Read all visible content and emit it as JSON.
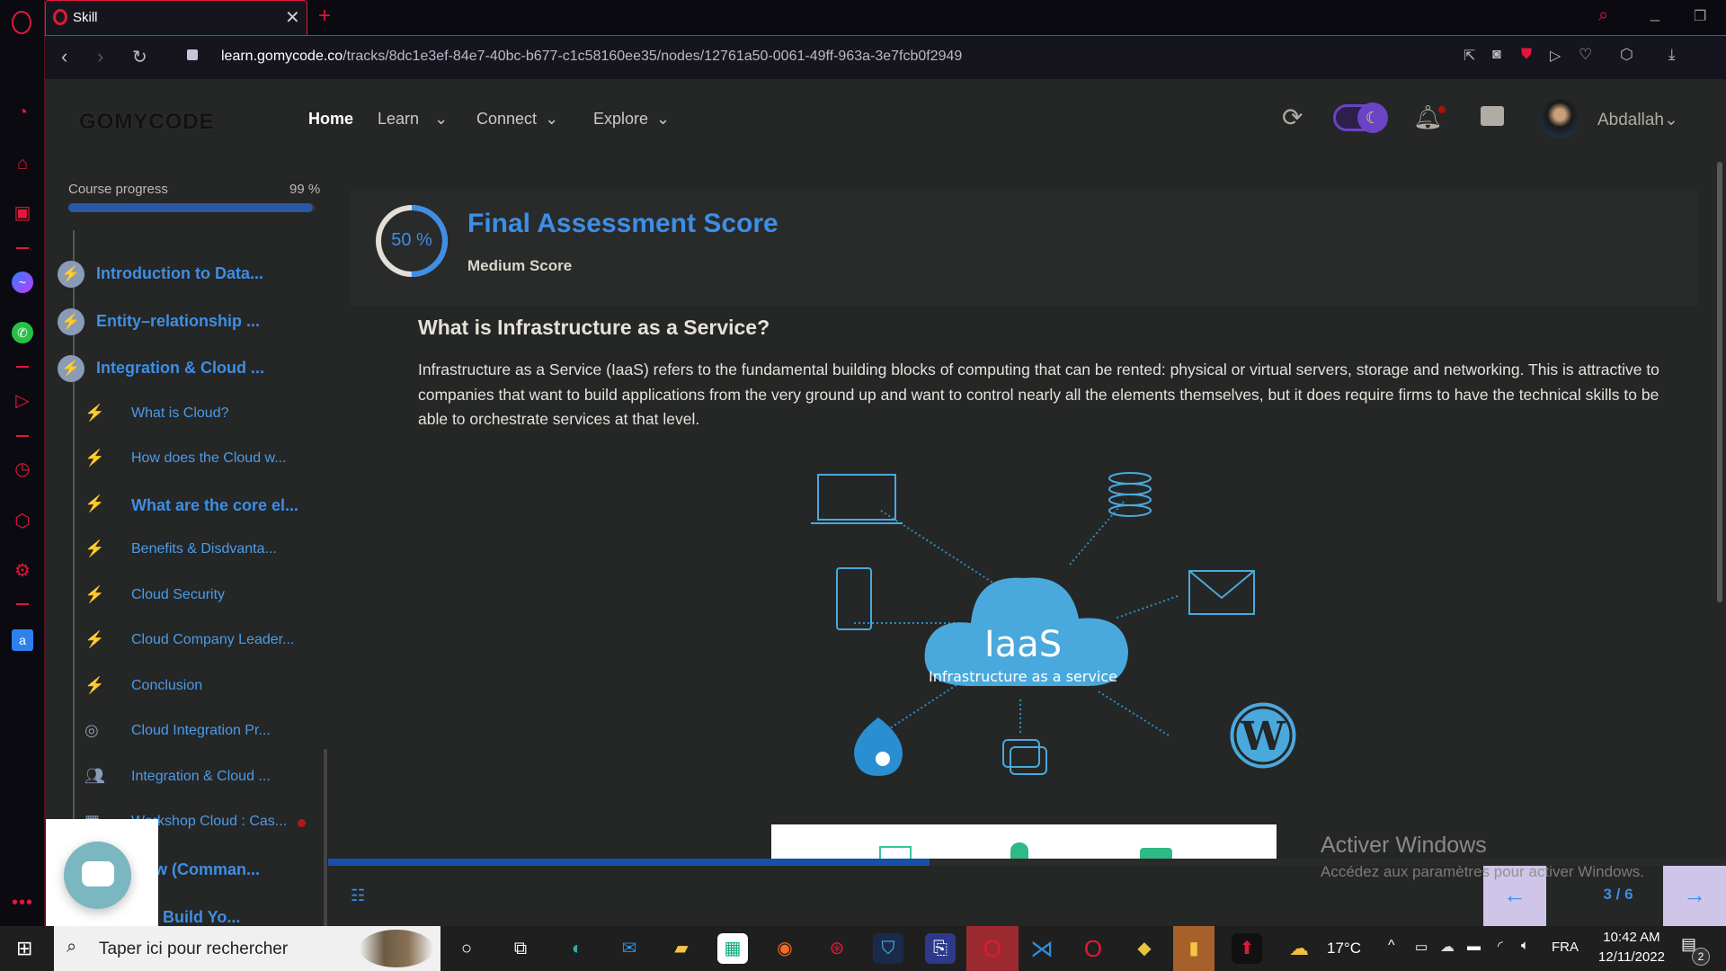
{
  "browser": {
    "tab_title": "Skill",
    "url_host": "learn.gomycode.co",
    "url_path": "/tracks/8dc1e3ef-84e7-40bc-b677-c1c58160ee35/nodes/12761a50-0061-49ff-963a-3e7fcb0f2949"
  },
  "header": {
    "logo": "GOMYCODE",
    "nav": [
      {
        "label": "Home"
      },
      {
        "label": "Learn"
      },
      {
        "label": "Connect"
      },
      {
        "label": "Explore"
      }
    ],
    "user": "Abdallah"
  },
  "sidebar": {
    "progress_label": "Course progress",
    "progress_text": "99 %",
    "progress": 0.99,
    "items": [
      {
        "label": "Introduction to Data...",
        "type": "module"
      },
      {
        "label": "Entity–relationship ...",
        "type": "module"
      },
      {
        "label": "Integration & Cloud ...",
        "type": "module"
      },
      {
        "label": "What is Cloud?",
        "type": "lesson"
      },
      {
        "label": "How does the Cloud w...",
        "type": "lesson"
      },
      {
        "label": "What are the core el...",
        "type": "lesson-active"
      },
      {
        "label": "Benefits & Disdvanta...",
        "type": "lesson"
      },
      {
        "label": "Cloud Security",
        "type": "lesson"
      },
      {
        "label": "Cloud Company Leader...",
        "type": "lesson"
      },
      {
        "label": "Conclusion",
        "type": "lesson"
      },
      {
        "label": "Cloud Integration Pr...",
        "type": "project"
      },
      {
        "label": "Integration & Cloud ...",
        "type": "group"
      },
      {
        "label": "Workshop Cloud : Cas...",
        "type": "workshop"
      },
      {
        "label": "Flow (Comman...",
        "type": "module"
      },
      {
        "label": "se : Build Yo...",
        "type": "module"
      }
    ]
  },
  "score": {
    "percent_text": "50 %",
    "percent": 50,
    "title": "Final Assessment Score",
    "subtitle": "Medium Score"
  },
  "content": {
    "heading": "What is Infrastructure as a Service?",
    "paragraph": "Infrastructure as a Service (IaaS) refers to the fundamental building blocks of computing that can be rented: physical or virtual servers, storage and networking. This is attractive to companies that want to build applications from the very ground up and want to control nearly all the elements themselves, but it does require firms to have the technical skills to be able to orchestrate services at that level.",
    "diagram": {
      "title": "IaaS",
      "subtitle": "Infrastructure as a service"
    }
  },
  "footer": {
    "page": "3 / 6",
    "lesson_progress": 0.5
  },
  "watermark": {
    "title": "Activer Windows",
    "text": "Accédez aux paramètres pour activer Windows."
  },
  "taskbar": {
    "search_placeholder": "Taper ici pour rechercher",
    "temp": "17°C",
    "lang": "FRA",
    "time": "10:42 AM",
    "date": "12/11/2022",
    "notif_count": "2"
  },
  "colors": {
    "accent": "#3d8ee6",
    "brand_red": "#e0183c",
    "cloud": "#4aa9dc"
  }
}
